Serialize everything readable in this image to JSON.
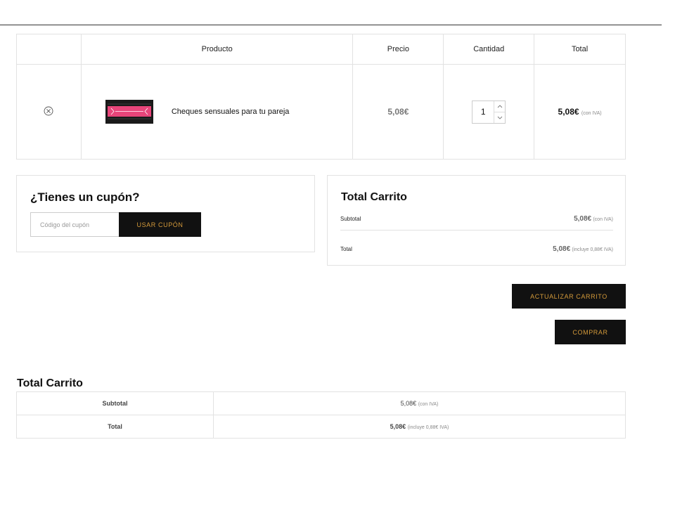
{
  "cart": {
    "headers": {
      "product": "Producto",
      "price": "Precio",
      "quantity": "Cantidad",
      "total": "Total"
    },
    "items": [
      {
        "name": "Cheques sensuales para tu pareja",
        "price": "5,08€",
        "quantity": "1",
        "total": "5,08€",
        "total_note": "(con IVA)"
      }
    ]
  },
  "coupon": {
    "title": "¿Tienes un cupón?",
    "placeholder": "Código del cupón",
    "button_label": "USAR CUPÓN"
  },
  "cart_totals": {
    "title": "Total Carrito",
    "subtotal_label": "Subtotal",
    "subtotal_value": "5,08€",
    "subtotal_note": "(con IVA)",
    "total_label": "Total",
    "total_value": "5,08€",
    "total_note": "(incluye 0,88€ IVA)"
  },
  "actions": {
    "update_label": "ACTUALIZAR CARRITO",
    "buy_label": "COMPRAR"
  },
  "bottom_totals": {
    "title": "Total Carrito",
    "subtotal_label": "Subtotal",
    "subtotal_value": "5,08€",
    "subtotal_note": "(con IVA)",
    "total_label": "Total",
    "total_value": "5,08€",
    "total_note": "(incluye 0,88€ IVA)"
  },
  "colors": {
    "button_bg": "#111111",
    "button_text": "#d49a3a",
    "border": "#e2e2e2",
    "product_accent": "#e8457a"
  },
  "icons": {
    "remove": "remove-circle-x-icon",
    "qty_up": "chevron-up-icon",
    "qty_down": "chevron-down-icon"
  }
}
